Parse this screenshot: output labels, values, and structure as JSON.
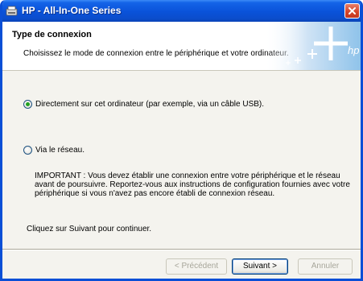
{
  "window": {
    "title": "HP - All-In-One Series",
    "close_icon": "close-icon"
  },
  "header": {
    "title": "Type de connexion",
    "subtitle": "Choisissez le mode de connexion entre le périphérique et votre ordinateur.",
    "logo_text": "hp"
  },
  "options": [
    {
      "label": "Directement sur cet ordinateur (par exemple, via un câble USB).",
      "selected": true
    },
    {
      "label": "Via le réseau.",
      "selected": false
    }
  ],
  "note": "IMPORTANT : Vous devez établir une connexion entre votre périphérique et le réseau avant de poursuivre. Reportez-vous aux instructions de configuration fournies avec votre périphérique si vous n'avez pas encore établi de connexion réseau.",
  "instruction": "Cliquez sur Suivant pour continuer.",
  "buttons": {
    "previous": "< Précédent",
    "next": "Suivant >",
    "cancel": "Annuler"
  },
  "colors": {
    "titlebar": "#0a52d9",
    "radio_dot": "#21a121",
    "close": "#d6452a"
  }
}
